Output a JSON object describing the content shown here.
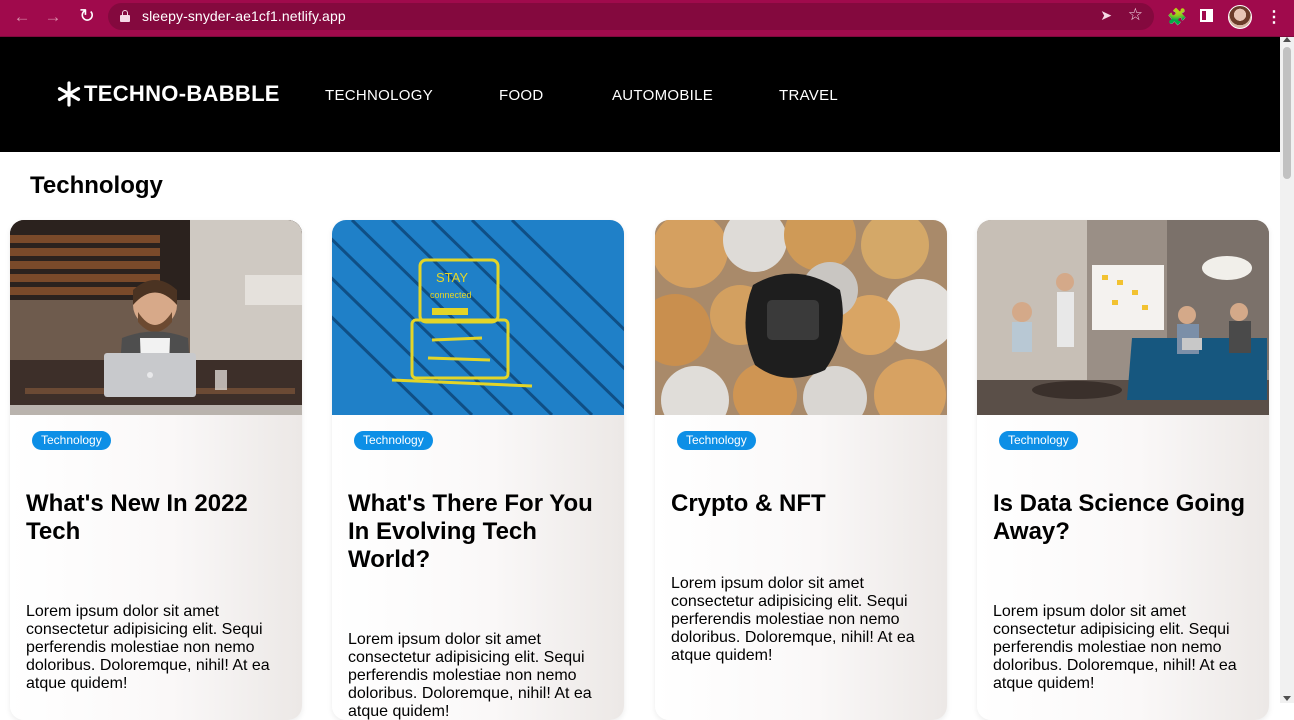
{
  "browser": {
    "url": "sleepy-snyder-ae1cf1.netlify.app",
    "icons": [
      "back-icon",
      "forward-icon",
      "reload-icon",
      "lock-icon",
      "share-icon",
      "star-icon",
      "extensions-icon",
      "side-panel-icon",
      "profile-avatar",
      "menu-icon"
    ],
    "accent_color": "#a00a4c"
  },
  "site": {
    "logo": "TECHNO-BABBLE",
    "nav": [
      "TECHNOLOGY",
      "FOOD",
      "AUTOMOBILE",
      "TRAVEL"
    ]
  },
  "main": {
    "section_title": "Technology",
    "cards": [
      {
        "tag": "Technology",
        "title": "What's New In 2022 Tech",
        "text": "Lorem ipsum dolor sit amet consectetur adipisicing elit. Sequi perferendis molestiae non nemo doloribus. Doloremque, nihil! At ea atque quidem!",
        "image": "man with laptop in cafe"
      },
      {
        "tag": "Technology",
        "title": "What's There For You In Evolving Tech World?",
        "text": "Lorem ipsum dolor sit amet consectetur adipisicing elit. Sequi perferendis molestiae non nemo doloribus. Doloremque, nihil! At ea atque quidem!",
        "image": "stay connected graffiti on blue wall"
      },
      {
        "tag": "Technology",
        "title": "Crypto & NFT",
        "text": "Lorem ipsum dolor sit amet consectetur adipisicing elit. Sequi perferendis molestiae non nemo doloribus. Doloremque, nihil! At ea atque quidem!",
        "image": "hardware wallet on coins"
      },
      {
        "tag": "Technology",
        "title": "Is Data Science Going Away?",
        "text": "Lorem ipsum dolor sit amet consectetur adipisicing elit. Sequi perferendis molestiae non nemo doloribus. Doloremque, nihil! At ea atque quidem!",
        "image": "team meeting in office"
      }
    ],
    "tag_color": "#0d8fe6"
  }
}
